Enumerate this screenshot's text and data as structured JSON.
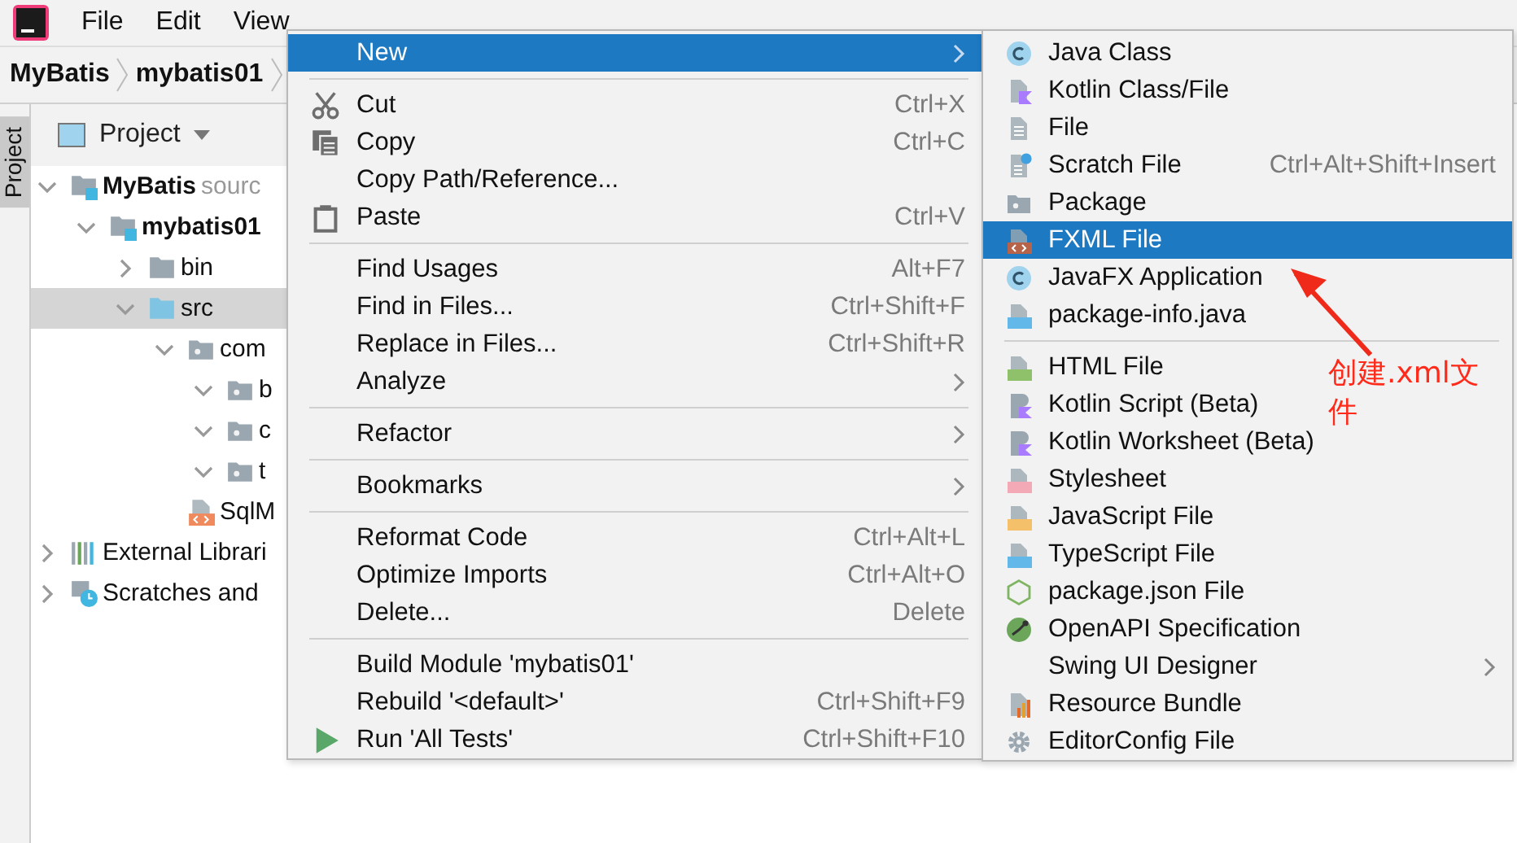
{
  "menubar": {
    "items": [
      {
        "label": "File"
      },
      {
        "label": "Edit"
      },
      {
        "label": "View"
      }
    ]
  },
  "breadcrumb": [
    "MyBatis",
    "mybatis01"
  ],
  "side_tab": {
    "label": "Project"
  },
  "project_panel": {
    "title": "Project",
    "tree": [
      {
        "label": "MyBatis",
        "note": "sourc",
        "bold": true,
        "kind": "module",
        "expanded": true,
        "selected": false,
        "children": [
          {
            "label": "mybatis01",
            "bold": true,
            "kind": "module",
            "expanded": true,
            "selected": false,
            "children": [
              {
                "label": "bin",
                "bold": false,
                "kind": "folder",
                "expanded": false,
                "selected": false
              },
              {
                "label": "src",
                "bold": false,
                "kind": "source",
                "expanded": true,
                "selected": true,
                "children": [
                  {
                    "label": "com",
                    "bold": false,
                    "kind": "package",
                    "expanded": true,
                    "selected": false,
                    "children": [
                      {
                        "label": "b",
                        "bold": false,
                        "kind": "package",
                        "expanded": true,
                        "selected": false
                      },
                      {
                        "label": "c",
                        "bold": false,
                        "kind": "package",
                        "expanded": true,
                        "selected": false
                      },
                      {
                        "label": "t",
                        "bold": false,
                        "kind": "package",
                        "expanded": true,
                        "selected": false
                      }
                    ]
                  },
                  {
                    "label": "SqlM",
                    "bold": false,
                    "kind": "xml",
                    "selected": false
                  }
                ]
              }
            ]
          }
        ]
      },
      {
        "label": "External Librari",
        "bold": false,
        "kind": "libraries",
        "expanded": false,
        "selected": false
      },
      {
        "label": "Scratches and",
        "bold": false,
        "kind": "scratches",
        "expanded": false,
        "selected": false
      }
    ]
  },
  "context_menu": {
    "groups": [
      [
        {
          "label": "New",
          "kind": "none",
          "submenu": true,
          "selected": true
        }
      ],
      [
        {
          "label": "Cut",
          "kind": "cut",
          "shortcut": "Ctrl+X",
          "selected": false
        },
        {
          "label": "Copy",
          "kind": "copy",
          "shortcut": "Ctrl+C",
          "selected": false
        },
        {
          "label": "Copy Path/Reference...",
          "kind": "none",
          "selected": false
        },
        {
          "label": "Paste",
          "kind": "paste",
          "shortcut": "Ctrl+V",
          "selected": false
        }
      ],
      [
        {
          "label": "Find Usages",
          "kind": "none",
          "shortcut": "Alt+F7",
          "selected": false
        },
        {
          "label": "Find in Files...",
          "kind": "none",
          "shortcut": "Ctrl+Shift+F",
          "selected": false
        },
        {
          "label": "Replace in Files...",
          "kind": "none",
          "shortcut": "Ctrl+Shift+R",
          "selected": false
        },
        {
          "label": "Analyze",
          "kind": "none",
          "submenu": true,
          "selected": false
        }
      ],
      [
        {
          "label": "Refactor",
          "kind": "none",
          "submenu": true,
          "selected": false
        }
      ],
      [
        {
          "label": "Bookmarks",
          "kind": "none",
          "submenu": true,
          "selected": false
        }
      ],
      [
        {
          "label": "Reformat Code",
          "kind": "none",
          "shortcut": "Ctrl+Alt+L",
          "selected": false
        },
        {
          "label": "Optimize Imports",
          "kind": "none",
          "shortcut": "Ctrl+Alt+O",
          "selected": false
        },
        {
          "label": "Delete...",
          "kind": "none",
          "shortcut": "Delete",
          "selected": false
        }
      ],
      [
        {
          "label": "Build Module 'mybatis01'",
          "kind": "none",
          "selected": false
        },
        {
          "label": "Rebuild '<default>'",
          "kind": "none",
          "shortcut": "Ctrl+Shift+F9",
          "selected": false
        },
        {
          "label": "Run 'All Tests'",
          "kind": "run",
          "shortcut": "Ctrl+Shift+F10",
          "selected": false
        }
      ]
    ]
  },
  "new_submenu": {
    "groups": [
      [
        {
          "label": "Java Class",
          "kind": "class",
          "selected": false
        },
        {
          "label": "Kotlin Class/File",
          "kind": "kotlin",
          "selected": false
        },
        {
          "label": "File",
          "kind": "file",
          "selected": false
        },
        {
          "label": "Scratch File",
          "kind": "scratch",
          "shortcut": "Ctrl+Alt+Shift+Insert",
          "selected": false
        },
        {
          "label": "Package",
          "kind": "package",
          "selected": false
        },
        {
          "label": "FXML File",
          "kind": "fxml",
          "selected": true
        },
        {
          "label": "JavaFX Application",
          "kind": "class",
          "selected": false
        },
        {
          "label": "package-info.java",
          "kind": "javadoc",
          "selected": false
        }
      ],
      [
        {
          "label": "HTML File",
          "kind": "html",
          "selected": false
        },
        {
          "label": "Kotlin Script (Beta)",
          "kind": "kscript",
          "selected": false
        },
        {
          "label": "Kotlin Worksheet (Beta)",
          "kind": "kscript",
          "selected": false
        },
        {
          "label": "Stylesheet",
          "kind": "css",
          "selected": false
        },
        {
          "label": "JavaScript File",
          "kind": "js",
          "selected": false
        },
        {
          "label": "TypeScript File",
          "kind": "ts",
          "selected": false
        },
        {
          "label": "package.json File",
          "kind": "node",
          "selected": false
        },
        {
          "label": "OpenAPI Specification",
          "kind": "openapi",
          "selected": false
        },
        {
          "label": "Swing UI Designer",
          "kind": "none",
          "submenu": true,
          "selected": false
        },
        {
          "label": "Resource Bundle",
          "kind": "bundle",
          "selected": false
        },
        {
          "label": "EditorConfig File",
          "kind": "gear",
          "selected": false
        }
      ]
    ]
  },
  "annotation": {
    "text": "创建.xml文件"
  }
}
